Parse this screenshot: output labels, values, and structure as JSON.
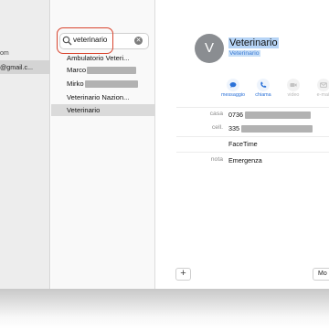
{
  "colors": {
    "accent": "#2c72d8",
    "highlight": "#d9452f",
    "avatar": "#8a8d91"
  },
  "sidebar": {
    "account_partial": "om",
    "email_partial": "@gmail.c..."
  },
  "search": {
    "value": "veterinario",
    "icon": "search-icon",
    "clear_icon": "close-circle-icon"
  },
  "contacts": [
    {
      "label": "Ambulatorio Veteri...",
      "redacted": false
    },
    {
      "label": "Marco",
      "redacted": true
    },
    {
      "label": "Mirko",
      "redacted": true
    },
    {
      "label": "Veterinario Nazion...",
      "redacted": false
    },
    {
      "label": "Veterinario",
      "redacted": false,
      "selected": true
    }
  ],
  "card": {
    "avatar_initial": "V",
    "name": "Veterinario",
    "subtitle": "Veterinario",
    "actions": [
      {
        "label": "messaggio",
        "icon": "message-icon",
        "enabled": true
      },
      {
        "label": "chiama",
        "icon": "phone-icon",
        "enabled": true
      },
      {
        "label": "video",
        "icon": "video-icon",
        "enabled": false
      },
      {
        "label": "e-mail",
        "icon": "mail-icon",
        "enabled": false
      }
    ],
    "fields": {
      "casa_label": "casa",
      "casa_value": "0736",
      "cell_label": "cell.",
      "cell_value": "335",
      "facetime_value": "FaceTime",
      "nota_label": "nota",
      "nota_value": "Emergenza"
    }
  },
  "footer": {
    "add_label": "+",
    "edit_label": "Mo"
  }
}
